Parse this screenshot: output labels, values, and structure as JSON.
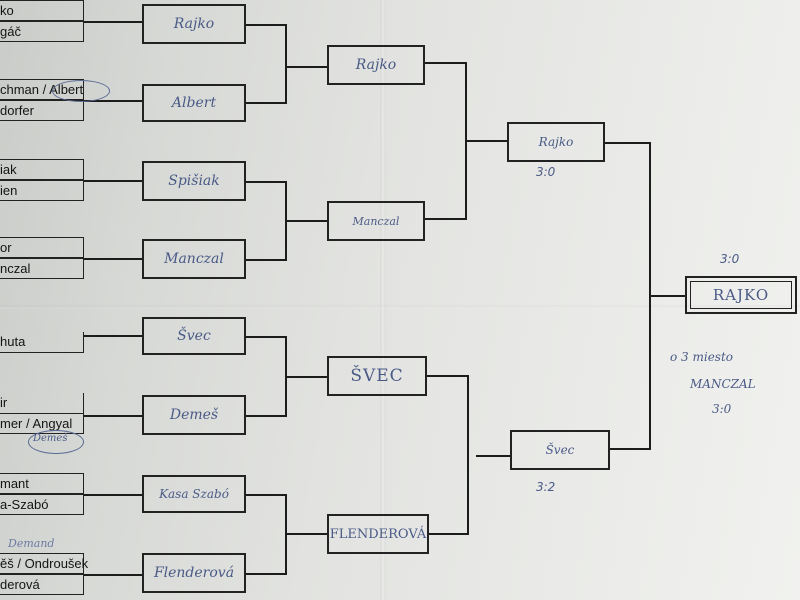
{
  "round1": {
    "names": [
      "ko",
      "gáč",
      "chman / Albert",
      "dorfer",
      "iak",
      "ien",
      "or",
      "nczal",
      "huta",
      "ir",
      "mer / Angyal",
      "mant",
      "a-Szabó",
      "ěš / Ondroušek",
      "derová"
    ]
  },
  "round2": {
    "winners": [
      "Rajko",
      "Albert",
      "Spišiak",
      "Manczal",
      "Švec",
      "Demeš",
      "Kasa Szabó",
      "Flenderová"
    ]
  },
  "round3": {
    "winners": [
      "Rajko",
      "Manczal",
      "ŠVEC",
      "FLENDEROVÁ"
    ]
  },
  "semis": {
    "top": {
      "name": "Rajko",
      "score": "3:0"
    },
    "bottom": {
      "name": "Švec",
      "score": "3:2"
    }
  },
  "final": {
    "name": "RAJKO",
    "score": "3:0"
  },
  "notes": {
    "circled_albert": "Albert",
    "circled_demes": "Demeš",
    "small_demand": "Demand",
    "third_place_line1": "o 3 miesto",
    "third_place_line2": "MANCZAL",
    "third_place_line3": "3:0"
  }
}
